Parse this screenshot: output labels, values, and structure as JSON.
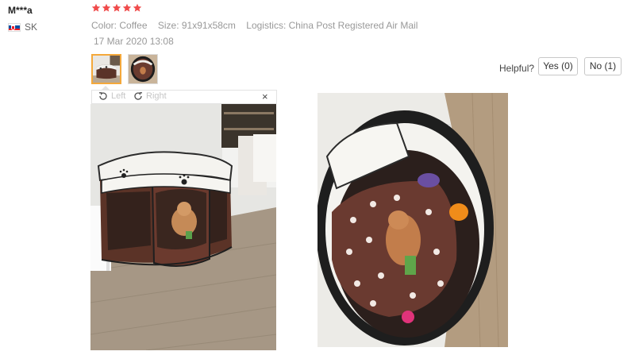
{
  "reviewer": {
    "name": "M***a",
    "country_code": "SK",
    "flag_icon": "slovakia-flag-icon"
  },
  "rating": {
    "stars": 5,
    "max": 5,
    "star_color": "#f04b4b"
  },
  "attributes": {
    "color_label": "Color:",
    "color_value": "Coffee",
    "size_label": "Size:",
    "size_value": "91x91x58cm",
    "logistics_label": "Logistics:",
    "logistics_value": "China Post Registered Air Mail"
  },
  "date": "17 Mar 2020 13:08",
  "thumbnails": [
    {
      "name": "review-photo-thumb-1",
      "active": true
    },
    {
      "name": "review-photo-thumb-2",
      "active": false
    }
  ],
  "viewer": {
    "rotate_left_label": "Left",
    "rotate_right_label": "Right",
    "close_label": "×"
  },
  "helpful": {
    "label": "Helpful?",
    "yes_label": "Yes (0)",
    "no_label": "No (1)"
  },
  "colors": {
    "accent_thumb_border": "#f4a83b",
    "muted_text": "#999999",
    "tent_brown": "#6b3a2e"
  }
}
